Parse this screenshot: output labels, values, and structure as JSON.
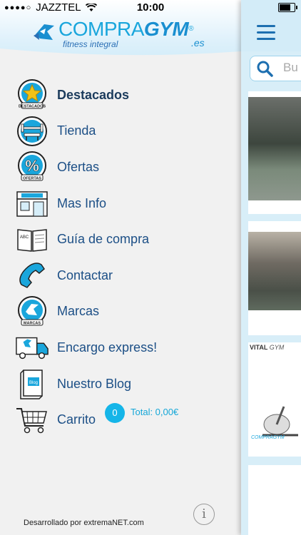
{
  "status_bar": {
    "signal_dots": "●●●●○",
    "carrier": "JAZZTEL",
    "time": "10:00",
    "battery_level": 0.85
  },
  "header": {
    "brand_prefix": "COMPRA",
    "brand_bold": "GYM",
    "tagline": "fitness integral",
    "tld": ".es"
  },
  "menu": {
    "items": [
      {
        "label": "Destacados",
        "icon": "star-badge-icon",
        "icon_caption": "DESTACADOS"
      },
      {
        "label": "Tienda",
        "icon": "weight-bench-icon"
      },
      {
        "label": "Ofertas",
        "icon": "percent-badge-icon",
        "icon_caption": "OFERTAS"
      },
      {
        "label": "Mas Info",
        "icon": "storefront-icon"
      },
      {
        "label": "Guía de compra",
        "icon": "book-icon",
        "icon_caption": "ABC"
      },
      {
        "label": "Contactar",
        "icon": "phone-icon"
      },
      {
        "label": "Marcas",
        "icon": "brands-badge-icon",
        "icon_caption": "MARCAS"
      },
      {
        "label": "Encargo express!",
        "icon": "delivery-truck-icon"
      },
      {
        "label": "Nuestro Blog",
        "icon": "blog-book-icon",
        "icon_caption": "Blog"
      },
      {
        "label": "Carrito",
        "icon": "shopping-cart-icon"
      }
    ]
  },
  "cart": {
    "count": "0",
    "total": "Total: 0,00€"
  },
  "footer": {
    "credit": "Desarrollado por extremaNET.com",
    "info_label": "i"
  },
  "content_panel": {
    "search_placeholder": "Bu",
    "product3_brand": "VITAL",
    "product3_sub": "GYM",
    "product3_watermark": "COMPRAGYM"
  },
  "colors": {
    "accent": "#1aa6dc",
    "label": "#1c4f86",
    "badge": "#15b5e8"
  }
}
